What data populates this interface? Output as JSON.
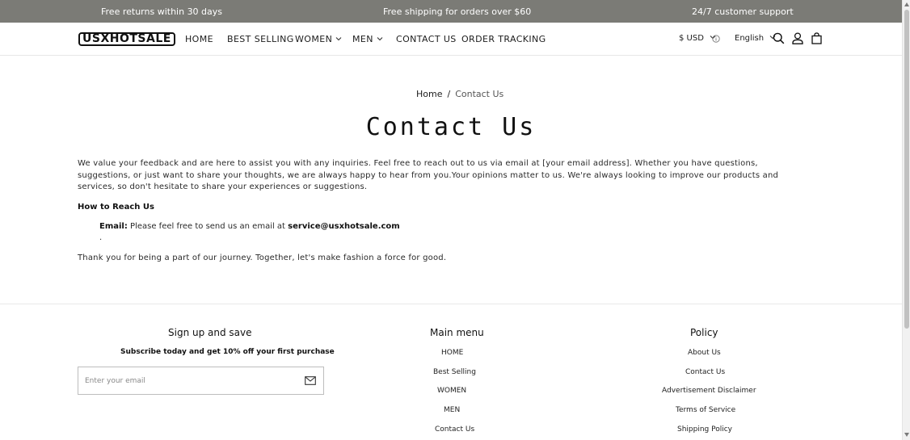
{
  "announcement": {
    "left": "Free returns within 30 days",
    "center": "Free shipping for orders over $60",
    "right": "24/7 customer support"
  },
  "header": {
    "logo": "USXHOTSALE",
    "nav": [
      {
        "label": "HOME"
      },
      {
        "label": "BEST SELLING"
      },
      {
        "label": "WOMEN",
        "has_dropdown": true
      },
      {
        "label": "MEN",
        "has_dropdown": true
      },
      {
        "label": "CONTACT US"
      },
      {
        "label": "ORDER TRACKING"
      }
    ],
    "currency": "$ USD",
    "language": "English",
    "icons": [
      "info-icon",
      "search-icon",
      "account-icon",
      "cart-icon"
    ]
  },
  "breadcrumb": {
    "home": "Home",
    "separator": "/",
    "current": "Contact Us"
  },
  "main": {
    "title": "Contact Us",
    "intro": "We value your feedback and are here to assist you with any inquiries. Feel free to reach out to us via email at [your email address]. Whether you have questions, suggestions, or just want to share your thoughts, we are always happy to hear from you.Your opinions matter to us. We're always looking to improve our products and services, so don't hesitate to share your experiences or suggestions.",
    "reach_heading": "How to Reach Us",
    "email_label": "Email:",
    "email_text": "Please feel free to send us an email at",
    "email_address": "service@usxhotsale.com",
    "dot": ".",
    "thanks": "Thank you for being a part of our journey. Together, let's make fashion a force for good."
  },
  "footer": {
    "signup": {
      "heading": "Sign up and save",
      "subtext": "Subscribe today and get 10% off your first purchase",
      "placeholder": "Enter your email"
    },
    "main_menu": {
      "heading": "Main menu",
      "links": [
        "HOME",
        "Best Selling",
        "WOMEN",
        "MEN",
        "Contact Us"
      ]
    },
    "policy": {
      "heading": "Policy",
      "links": [
        "About Us",
        "Contact Us",
        "Advertisement Disclaimer",
        "Terms of Service",
        "Shipping Policy"
      ]
    }
  },
  "colors": {
    "announcement_bg": "#7b7b76",
    "text": "#1c1c1c"
  }
}
